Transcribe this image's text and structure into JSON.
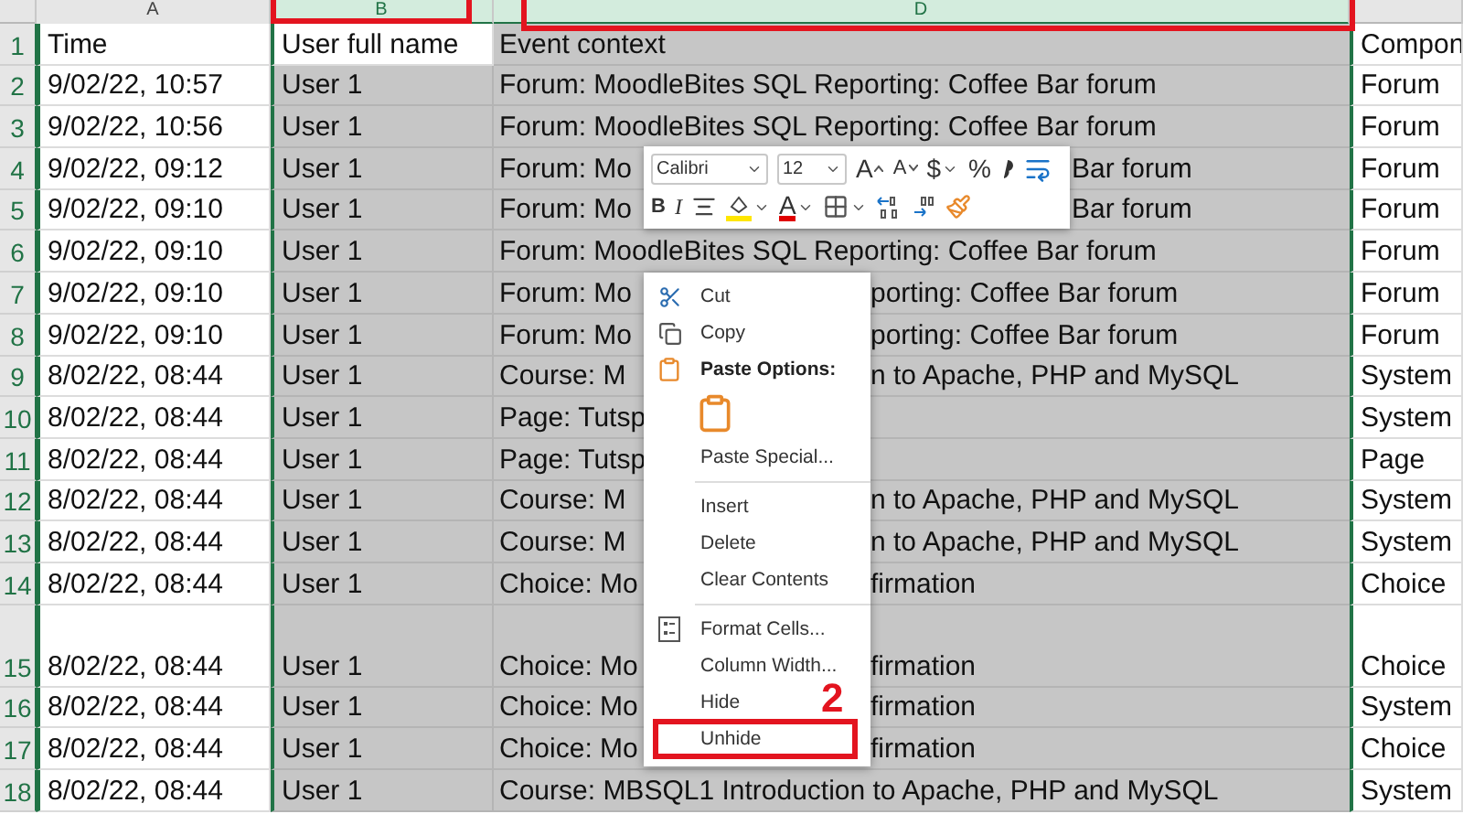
{
  "columns": [
    {
      "letter": "A",
      "selected": false
    },
    {
      "letter": "B",
      "selected": true
    },
    {
      "letter": "D",
      "selected": true
    }
  ],
  "rows": [
    {
      "num": "1",
      "time": "Time",
      "user": "User full name",
      "event": {
        "left": "Event context"
      },
      "component": "Compon",
      "tall": false
    },
    {
      "num": "2",
      "time": "9/02/22, 10:57",
      "user": "User 1",
      "event": {
        "left": "Forum: MoodleBites SQL Reporting: Coffee Bar forum"
      },
      "component": "Forum",
      "tall": false
    },
    {
      "num": "3",
      "time": "9/02/22, 10:56",
      "user": "User 1",
      "event": {
        "left": "Forum: MoodleBites SQL Reporting: Coffee Bar forum"
      },
      "component": "Forum",
      "tall": false
    },
    {
      "num": "4",
      "time": "9/02/22, 09:12",
      "user": "User 1",
      "event": {
        "left": "Forum: Mo",
        "right": "Bar forum"
      },
      "component": "Forum",
      "tall": false
    },
    {
      "num": "5",
      "time": "9/02/22, 09:10",
      "user": "User 1",
      "event": {
        "left": "Forum: Mo",
        "right": "Bar forum"
      },
      "component": "Forum",
      "tall": false
    },
    {
      "num": "6",
      "time": "9/02/22, 09:10",
      "user": "User 1",
      "event": {
        "left": "Forum: MoodleBites SQL Reporting: Coffee Bar forum"
      },
      "component": "Forum",
      "tall": false
    },
    {
      "num": "7",
      "time": "9/02/22, 09:10",
      "user": "User 1",
      "event": {
        "left": "Forum: Mo",
        "right": "porting: Coffee Bar forum"
      },
      "component": "Forum",
      "tall": false
    },
    {
      "num": "8",
      "time": "9/02/22, 09:10",
      "user": "User 1",
      "event": {
        "left": "Forum: Mo",
        "right": "porting: Coffee Bar forum"
      },
      "component": "Forum",
      "tall": false
    },
    {
      "num": "9",
      "time": "8/02/22, 08:44",
      "user": "User 1",
      "event": {
        "left": "Course: M",
        "right": "n to Apache, PHP and MySQL"
      },
      "component": "System",
      "tall": false
    },
    {
      "num": "10",
      "time": "8/02/22, 08:44",
      "user": "User 1",
      "event": {
        "left": "Page: Tutsp"
      },
      "component": "System",
      "tall": false
    },
    {
      "num": "11",
      "time": "8/02/22, 08:44",
      "user": "User 1",
      "event": {
        "left": "Page: Tutsp"
      },
      "component": "Page",
      "tall": false
    },
    {
      "num": "12",
      "time": "8/02/22, 08:44",
      "user": "User 1",
      "event": {
        "left": "Course: M",
        "right": "n to Apache, PHP and MySQL"
      },
      "component": "System",
      "tall": false
    },
    {
      "num": "13",
      "time": "8/02/22, 08:44",
      "user": "User 1",
      "event": {
        "left": "Course: M",
        "right": "n to Apache, PHP and MySQL"
      },
      "component": "System",
      "tall": false
    },
    {
      "num": "14",
      "time": "8/02/22, 08:44",
      "user": "User 1",
      "event": {
        "left": "Choice: Mo",
        "right": "firmation"
      },
      "component": "Choice",
      "tall": false
    },
    {
      "num": "15",
      "time": "8/02/22, 08:44",
      "user": "User 1",
      "event": {
        "left": "Choice: Mo",
        "right": "firmation"
      },
      "component": "Choice",
      "tall": true
    },
    {
      "num": "16",
      "time": "8/02/22, 08:44",
      "user": "User 1",
      "event": {
        "left": "Choice: Mo",
        "right": "firmation"
      },
      "component": "System",
      "tall": false
    },
    {
      "num": "17",
      "time": "8/02/22, 08:44",
      "user": "User 1",
      "event": {
        "left": "Choice: Mo",
        "right": "firmation"
      },
      "component": "Choice",
      "tall": false
    },
    {
      "num": "18",
      "time": "8/02/22, 08:44",
      "user": "User 1",
      "event": {
        "left": "Course: MBSQL1 Introduction to Apache, PHP and MySQL"
      },
      "component": "System",
      "tall": false
    }
  ],
  "toolbar": {
    "font": "Calibri",
    "size": "12",
    "row1": [
      {
        "kind": "grow",
        "text": "A"
      },
      {
        "kind": "shrink",
        "text": "A"
      },
      {
        "kind": "currency",
        "text": "$",
        "dropdown": true
      },
      {
        "kind": "percent",
        "text": "%"
      },
      {
        "kind": "comma"
      },
      {
        "kind": "wrap"
      }
    ],
    "row2": [
      {
        "kind": "bold",
        "text": "B"
      },
      {
        "kind": "italic",
        "text": "I"
      },
      {
        "kind": "align"
      },
      {
        "kind": "fill",
        "dropdown": true
      },
      {
        "kind": "font-color",
        "text": "A",
        "dropdown": true
      },
      {
        "kind": "borders",
        "dropdown": true
      },
      {
        "kind": "add-decimal"
      },
      {
        "kind": "remove-decimal"
      },
      {
        "kind": "painter"
      }
    ]
  },
  "context_menu": [
    {
      "kind": "item",
      "label": "Cut",
      "highlighted": false
    },
    {
      "kind": "item",
      "label": "Copy",
      "highlighted": false
    },
    {
      "kind": "heading",
      "label": "Paste Options:"
    },
    {
      "kind": "paste-option"
    },
    {
      "kind": "item",
      "label": "Paste Special...",
      "highlighted": false
    },
    {
      "kind": "item",
      "label": "Insert",
      "separator_before": true,
      "highlighted": false
    },
    {
      "kind": "item",
      "label": "Delete",
      "highlighted": false
    },
    {
      "kind": "item",
      "label": "Clear Contents",
      "highlighted": false
    },
    {
      "kind": "item",
      "label": "Format Cells...",
      "separator_before": true,
      "highlighted": false
    },
    {
      "kind": "item",
      "label": "Column Width...",
      "highlighted": false
    },
    {
      "kind": "item",
      "label": "Hide",
      "highlighted": false
    },
    {
      "kind": "item",
      "label": "Unhide",
      "highlighted": true
    }
  ],
  "step_label": "2"
}
